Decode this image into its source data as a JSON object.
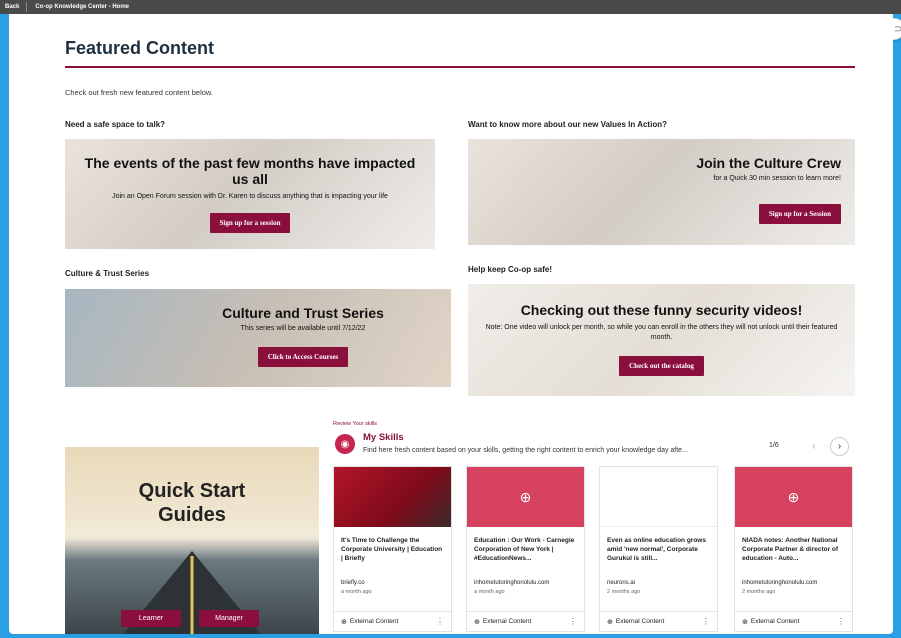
{
  "topbar": {
    "back_label": "Back",
    "breadcrumb": "Co-op Knowledge Center - Home"
  },
  "page": {
    "title": "Featured Content",
    "intro": "Check out fresh new featured content below."
  },
  "colors": {
    "accent": "#8a0f3c",
    "card_pink": "#d5415f",
    "frame_blue": "#2a9fe3"
  },
  "sections": {
    "talk": {
      "heading": "Need a safe space to talk?",
      "banner_title": "The events of the past few months have impacted us all",
      "banner_text": "Join an Open Forum session with Dr. Karen to discuss anything that is impacting your life",
      "button": "Sign up for a session"
    },
    "values": {
      "heading": "Want to know more about our new Values In Action?",
      "banner_title": "Join the Culture Crew",
      "banner_text": "for a Quick 30 min session to learn more!",
      "button": "Sign up for a Session"
    },
    "culture": {
      "heading": "Culture & Trust Series",
      "banner_title": "Culture and Trust Series",
      "banner_text": "This series will be available until 7/12/22",
      "button": "Click to Access Courses"
    },
    "safety": {
      "heading": "Help keep Co-op safe!",
      "banner_title": "Checking out these funny security videos!",
      "banner_text": "Note: One video will unlock per month, so while you can enroll in the others they will not unlock until their featured month.",
      "button": "Check out the catalog"
    }
  },
  "quick_start": {
    "title_line1": "Quick Start",
    "title_line2": "Guides",
    "learner_button": "Learner",
    "manager_button": "Manager"
  },
  "skills": {
    "label": "Review Your skills",
    "title": "My Skills",
    "description": "Find here fresh content based on your skills, getting the right content to enrich your knowledge day afte...",
    "pager": "1/6",
    "cards": [
      {
        "title": "It's Time to Challenge the Corporate University | Education | Briefly",
        "source": "briefly.co",
        "age": "a month ago",
        "type": "External Content",
        "image": "photo"
      },
      {
        "title": "Education : Our Work - Carnegie Corporation of New York | #EducationNews...",
        "source": "inhometutoringhonolulu.com",
        "age": "a month ago",
        "type": "External Content",
        "image": "pink"
      },
      {
        "title": "Even as online education grows amid 'new normal', Corporate Gurukul is still...",
        "source": "neurons.ai",
        "age": "2 months ago",
        "type": "External Content",
        "image": "white"
      },
      {
        "title": "NIADA notes: Another National Corporate Partner & director of education - Auto...",
        "source": "inhometutoringhonolulu.com",
        "age": "2 months ago",
        "type": "External Content",
        "image": "pink"
      }
    ]
  },
  "icons": {
    "share": "link-icon",
    "skills": "compass-icon",
    "card_placeholder": "globe-icon",
    "prev": "chevron-left-icon",
    "next": "chevron-right-icon",
    "more": "kebab-menu-icon"
  }
}
